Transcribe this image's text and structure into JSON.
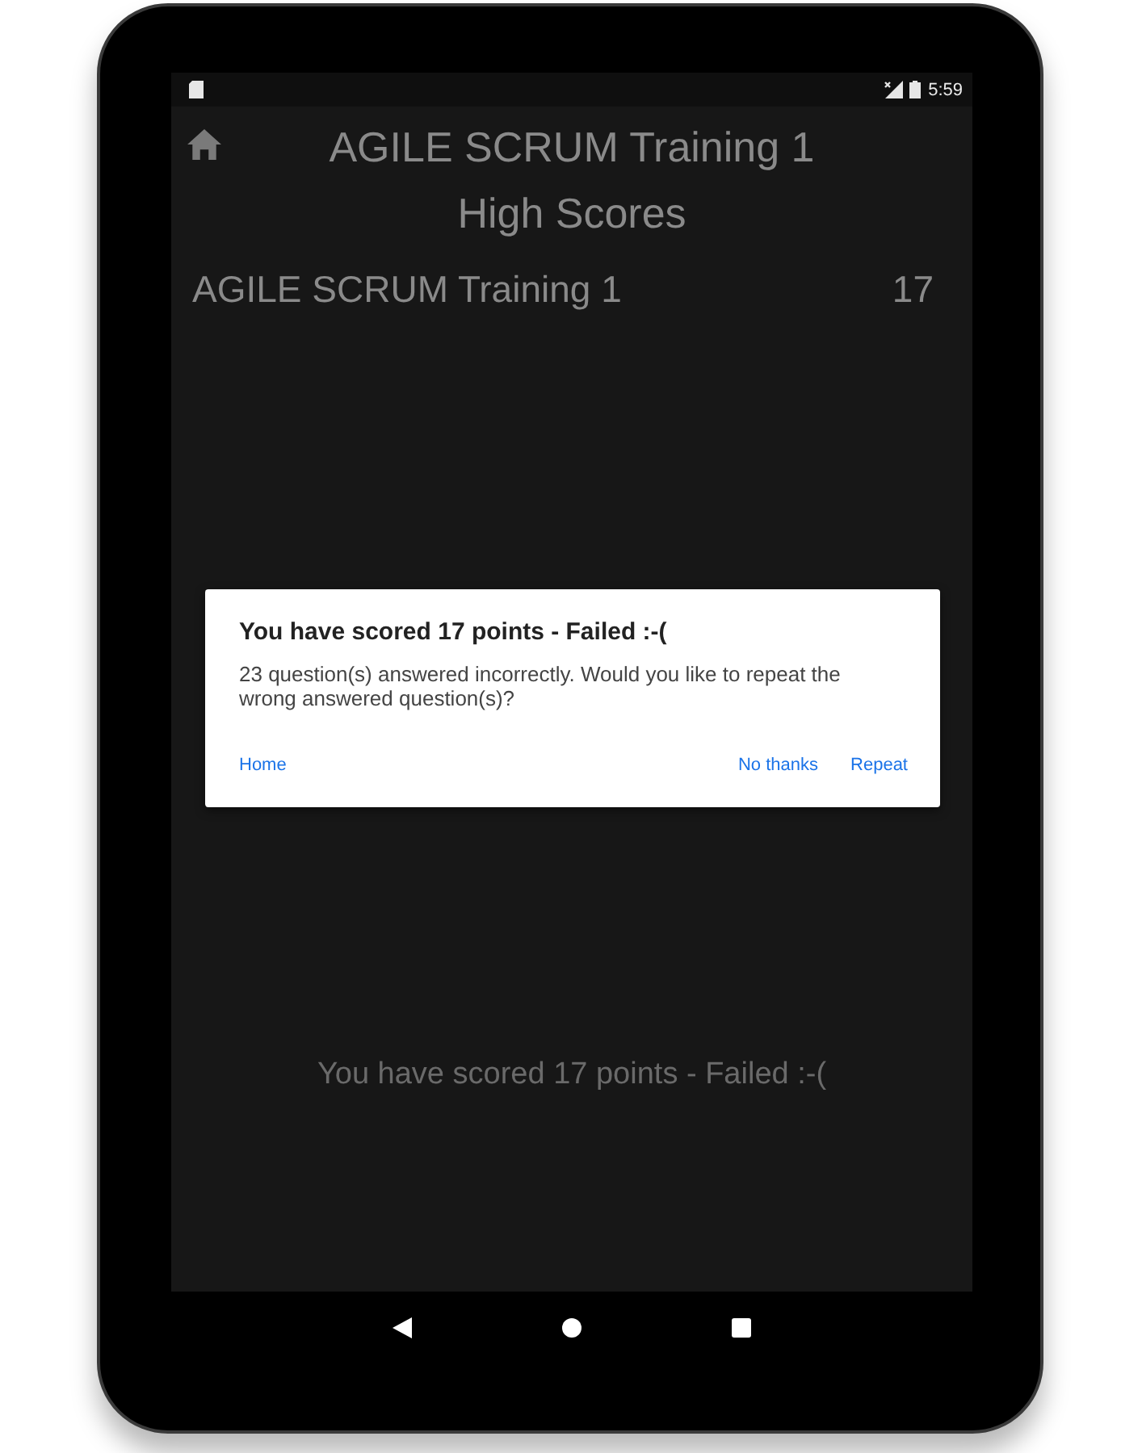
{
  "status_bar": {
    "time": "5:59"
  },
  "app_bar": {
    "title": "AGILE SCRUM Training 1",
    "subtitle": "High Scores"
  },
  "scores": [
    {
      "name": "AGILE SCRUM Training 1",
      "score": "17"
    }
  ],
  "dialog": {
    "title": "You have scored 17 points - Failed :-(",
    "message": "23 question(s) answered incorrectly. Would you like to repeat the wrong answered question(s)?",
    "buttons": [
      {
        "label": "Home",
        "kind": "neutral"
      },
      {
        "label": "No thanks",
        "kind": "negative"
      },
      {
        "label": "Repeat",
        "kind": "positive"
      }
    ]
  },
  "result_text": "You have scored 17 points - Failed :-("
}
